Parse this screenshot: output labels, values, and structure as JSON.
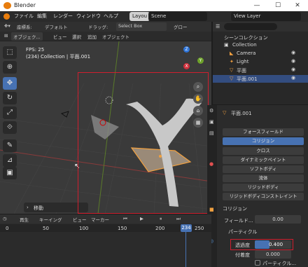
{
  "window": {
    "title": "Blender",
    "minimize": "—",
    "maximize": "☐",
    "close": "✕"
  },
  "menu": {
    "items": [
      "ファイル",
      "編集",
      "レンダー",
      "ウィンドウ",
      "ヘルプ"
    ],
    "workspace_tab": "Layou",
    "scene": "Scene",
    "view_layer": "View Layer"
  },
  "header": {
    "transform_label": "座標系:",
    "transform_value": "デフォルト",
    "drag_label": "ドラッグ:",
    "drag_value": "Select Box",
    "global_value": "グロー",
    "mode": "オブジェク...",
    "view": "ビュー",
    "select": "選択",
    "add": "追加",
    "object": "オブジェクト"
  },
  "viewport": {
    "fps": "FPS: 25",
    "info": "(234) Collection | 平面.001",
    "last_op": "移動",
    "gizmo": {
      "z": "Z",
      "y": "Y",
      "x": "X"
    }
  },
  "outliner": {
    "title": "シーンコレクション",
    "items": [
      {
        "label": "Collection"
      },
      {
        "label": "Camera"
      },
      {
        "label": "Light"
      },
      {
        "label": "平面"
      },
      {
        "label": "平面.001"
      }
    ]
  },
  "properties": {
    "object_name": "平面.001",
    "physics_buttons": [
      "フォースフィールド",
      "コリジョン",
      "クロス",
      "ダイナミックペイント",
      "ソフトボディ",
      "流体",
      "リジッドボディ",
      "リジッドボディコンストレイント"
    ],
    "collision_section": "コリジョン",
    "field_label": "フィールド...",
    "field_value": "0.00",
    "particle_section": "パーティクル",
    "permeability_label": "透過度",
    "permeability_value": "0.400",
    "stickiness_label": "付着度",
    "stickiness_value": "0.000",
    "particle_kill": "パーティクル..."
  },
  "timeline": {
    "playback": "再生",
    "keying": "キーイング",
    "view": "ビュー",
    "marker": "マーカー",
    "current_frame": "234",
    "ticks": [
      "0",
      "50",
      "100",
      "150",
      "200",
      "250"
    ]
  },
  "colors": {
    "accent": "#4772b3",
    "highlight_box": "#d01e2e",
    "selected_orange": "#f0a040"
  }
}
